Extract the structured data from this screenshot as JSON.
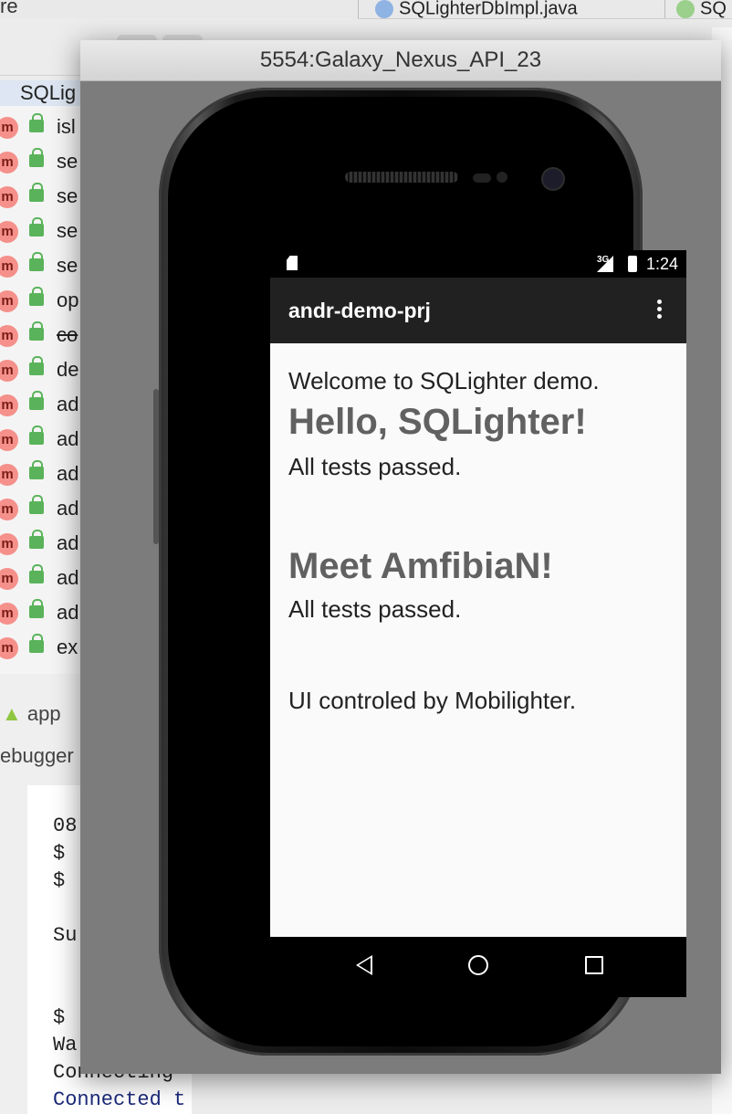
{
  "ide": {
    "toolbar_fragment": "re",
    "tabs": [
      {
        "label": "SQLighterDbImpl.java"
      },
      {
        "label": "SQ"
      }
    ],
    "structure": {
      "root_label": "SQLig",
      "members": [
        "isl",
        "se",
        "se",
        "se",
        "se",
        "op",
        "co",
        "de",
        "ad",
        "ad",
        "ad",
        "ad",
        "ad",
        "ad",
        "ad",
        "ex"
      ],
      "member_badge": "m"
    },
    "bottom": {
      "app_label": "app",
      "debugger_label": "ebugger"
    },
    "console_lines": [
      "08",
      "$ ",
      "$ ",
      "Su",
      "$ ",
      "Wa",
      "Connecting",
      "Connected t"
    ],
    "colors": {
      "accent_blue": "#1b2a7a",
      "method_badge": "#f5908a",
      "lock_green": "#5ab35a"
    }
  },
  "emulator": {
    "window_title": "5554:Galaxy_Nexus_API_23"
  },
  "device": {
    "status": {
      "network": "3G",
      "time": "1:24"
    },
    "app_title": "andr-demo-prj",
    "content": {
      "welcome": "Welcome to SQLighter demo.",
      "heading1": "Hello, SQLighter!",
      "result1": "All tests passed.",
      "heading2": "Meet AmfibiaN!",
      "result2": "All tests passed.",
      "footer": "UI controled by Mobilighter."
    }
  }
}
